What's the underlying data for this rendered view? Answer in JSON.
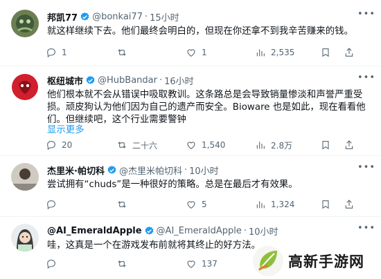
{
  "tweets": [
    {
      "name": "邦凯77",
      "handle": "@bonkai77",
      "time": "15小时",
      "text": "就这样继续下去。他们最终会明白的，但现在你还拿不到我辛苦赚来的钱。",
      "replies": "1",
      "retweets": "",
      "likes": "1",
      "views": "2,535"
    },
    {
      "name": "枢纽城市",
      "handle": "@HubBandar",
      "time": "16小时",
      "text": "他们根本就不会从错误中吸取教训。这条路总是会导致销量惨淡和声誉严重受损。顽皮狗认为他们因为自己的遗产而安全。Bioware 也是如此，现在看看他们。但继续吧，这个行业需要警钟",
      "show_more": "显示更多",
      "replies": "20",
      "retweets": "二十六",
      "likes": "1,540",
      "views": "2.8万"
    },
    {
      "name": "杰里米·帕切科",
      "handle": "@杰里米帕切科",
      "time": "10小时",
      "text": "尝试拥有“chuds”是一种很好的策略。总是在最后才有效果。",
      "replies": "",
      "retweets": "",
      "likes": "5",
      "views": "1,324"
    },
    {
      "name": "@AI_EmeraldApple",
      "handle": "@AI_EmeraldApple",
      "time": "10小时",
      "text": "哇，这真是一个在游戏发布前就将其终止的好方法。",
      "replies": "",
      "retweets": "",
      "likes": "137",
      "views": ""
    }
  ],
  "separator": "·",
  "watermark": {
    "text": "高新手游网"
  },
  "colors": {
    "accent": "#1d9bf0",
    "secondary_text": "#536471",
    "divider": "#eff3f4"
  }
}
